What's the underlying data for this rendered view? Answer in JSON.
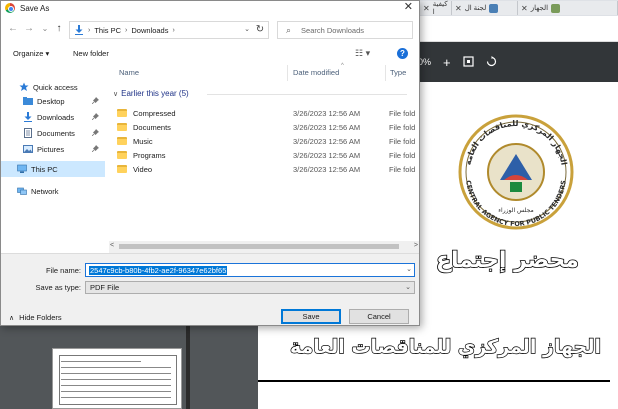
{
  "browser": {
    "tabs": [
      {
        "label": "الجهاز",
        "close": "✕",
        "color": "#7a9b5a"
      },
      {
        "label": "لجنة ال",
        "close": "✕",
        "color": "#4a7fb5"
      },
      {
        "label": "كيفية ا",
        "close": "✕",
        "color": "#c94a3a"
      }
    ],
    "zoom": "0%",
    "zoom_plus": "+"
  },
  "pdf": {
    "heading_ar": "محضر إجتماع",
    "org_ar": "الجهاز المركزي للمناقصات العامة",
    "logo_text_ar": "الجهاز المركزي للمناقصات العامة",
    "logo_text_en": "CENTRAL AGENCY FOR PUBLIC TENDERS",
    "logo_sub_ar": "مجلس الوزراء"
  },
  "dialog": {
    "title": "Save As",
    "close_glyph": "✕",
    "nav": {
      "back": "←",
      "forward": "→",
      "recent": "⌄",
      "up": "↑",
      "refresh": "↻",
      "crumbs": [
        "This PC",
        "Downloads"
      ],
      "crumb_sep": "›",
      "dd": "⌄",
      "search_placeholder": "Search Downloads",
      "search_icon": "⌕"
    },
    "toolbar": {
      "organize": "Organize ▾",
      "new_folder": "New folder",
      "view": "☷ ▾",
      "help": "?"
    },
    "nav_pane": [
      {
        "label": "Quick access",
        "icon": "star-icon",
        "pinned": false
      },
      {
        "label": "Desktop",
        "icon": "desktop-folder-icon",
        "pinned": true
      },
      {
        "label": "Downloads",
        "icon": "download-icon",
        "pinned": true
      },
      {
        "label": "Documents",
        "icon": "documents-icon",
        "pinned": true
      },
      {
        "label": "Pictures",
        "icon": "pictures-icon",
        "pinned": true
      },
      {
        "label": "This PC",
        "icon": "computer-icon",
        "pinned": false,
        "selected": true
      },
      {
        "label": "Network",
        "icon": "network-icon",
        "pinned": false
      }
    ],
    "pin_glyph": "📌",
    "columns": {
      "name": "Name",
      "date": "Date modified",
      "type": "Type",
      "sort_glyph": "^"
    },
    "group": {
      "label": "Earlier this year (5)",
      "chevron": "∨"
    },
    "files": [
      {
        "name": "Compressed",
        "date": "3/26/2023 12:56 AM",
        "type": "File fold"
      },
      {
        "name": "Documents",
        "date": "3/26/2023 12:56 AM",
        "type": "File fold"
      },
      {
        "name": "Music",
        "date": "3/26/2023 12:56 AM",
        "type": "File fold"
      },
      {
        "name": "Programs",
        "date": "3/26/2023 12:56 AM",
        "type": "File fold"
      },
      {
        "name": "Video",
        "date": "3/26/2023 12:56 AM",
        "type": "File fold"
      }
    ],
    "scroll": {
      "left": "<",
      "right": ">"
    },
    "file_name_label": "File name:",
    "file_name_value": "2547c9cb-b80b-4fb2-ae2f-96347e62bf65",
    "save_type_label": "Save as type:",
    "save_type_value": "PDF File",
    "hide_folders": "Hide Folders",
    "hide_glyph": "∧",
    "save_label": "Save",
    "cancel_label": "Cancel"
  }
}
